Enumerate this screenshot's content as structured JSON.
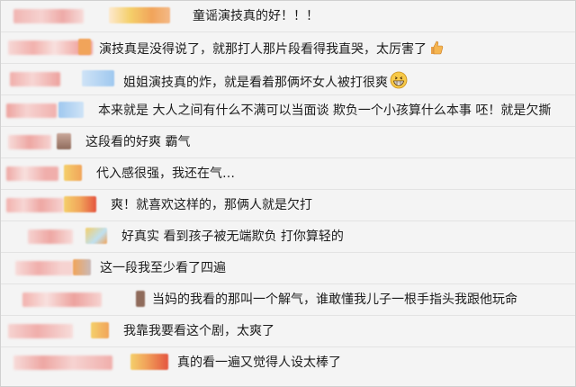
{
  "comments": [
    {
      "text": "童谣演技真的好！！！",
      "emoji": ""
    },
    {
      "text": "演技真是没得说了，就那打人那片段看得我直哭，太厉害了",
      "emoji": "thumbs-up-icon"
    },
    {
      "text": "姐姐演技真的炸，就是看着那俩坏女人被打很爽",
      "emoji": "grin-icon"
    },
    {
      "text": "本来就是 大人之间有什么不满可以当面谈 欺负一个小孩算什么本事 呸！就是欠撕",
      "emoji": ""
    },
    {
      "text": "这段看的好爽  霸气",
      "emoji": ""
    },
    {
      "text": "代入感很强，我还在气…",
      "emoji": ""
    },
    {
      "text": "爽！就喜欢这样的，那俩人就是欠打",
      "emoji": ""
    },
    {
      "text": "好真实  看到孩子被无端欺负  打你算轻的",
      "emoji": ""
    },
    {
      "text": "这一段我至少看了四遍",
      "emoji": ""
    },
    {
      "text": "当妈的我看的那叫一个解气，谁敢懂我儿子一根手指头我跟他玩命",
      "emoji": ""
    },
    {
      "text": "我靠我要看这个剧，太爽了",
      "emoji": ""
    },
    {
      "text": "真的看一遍又觉得人设太棒了",
      "emoji": ""
    }
  ],
  "colors": {
    "blur_name_pink": "#f3a9a6",
    "blur_name_grey": "#c9b9b8",
    "avatar_orange": "#f1a45a",
    "avatar_blue": "#9fc8ef",
    "avatar_yellow": "#f4cf6a",
    "avatar_red": "#e4553f"
  }
}
